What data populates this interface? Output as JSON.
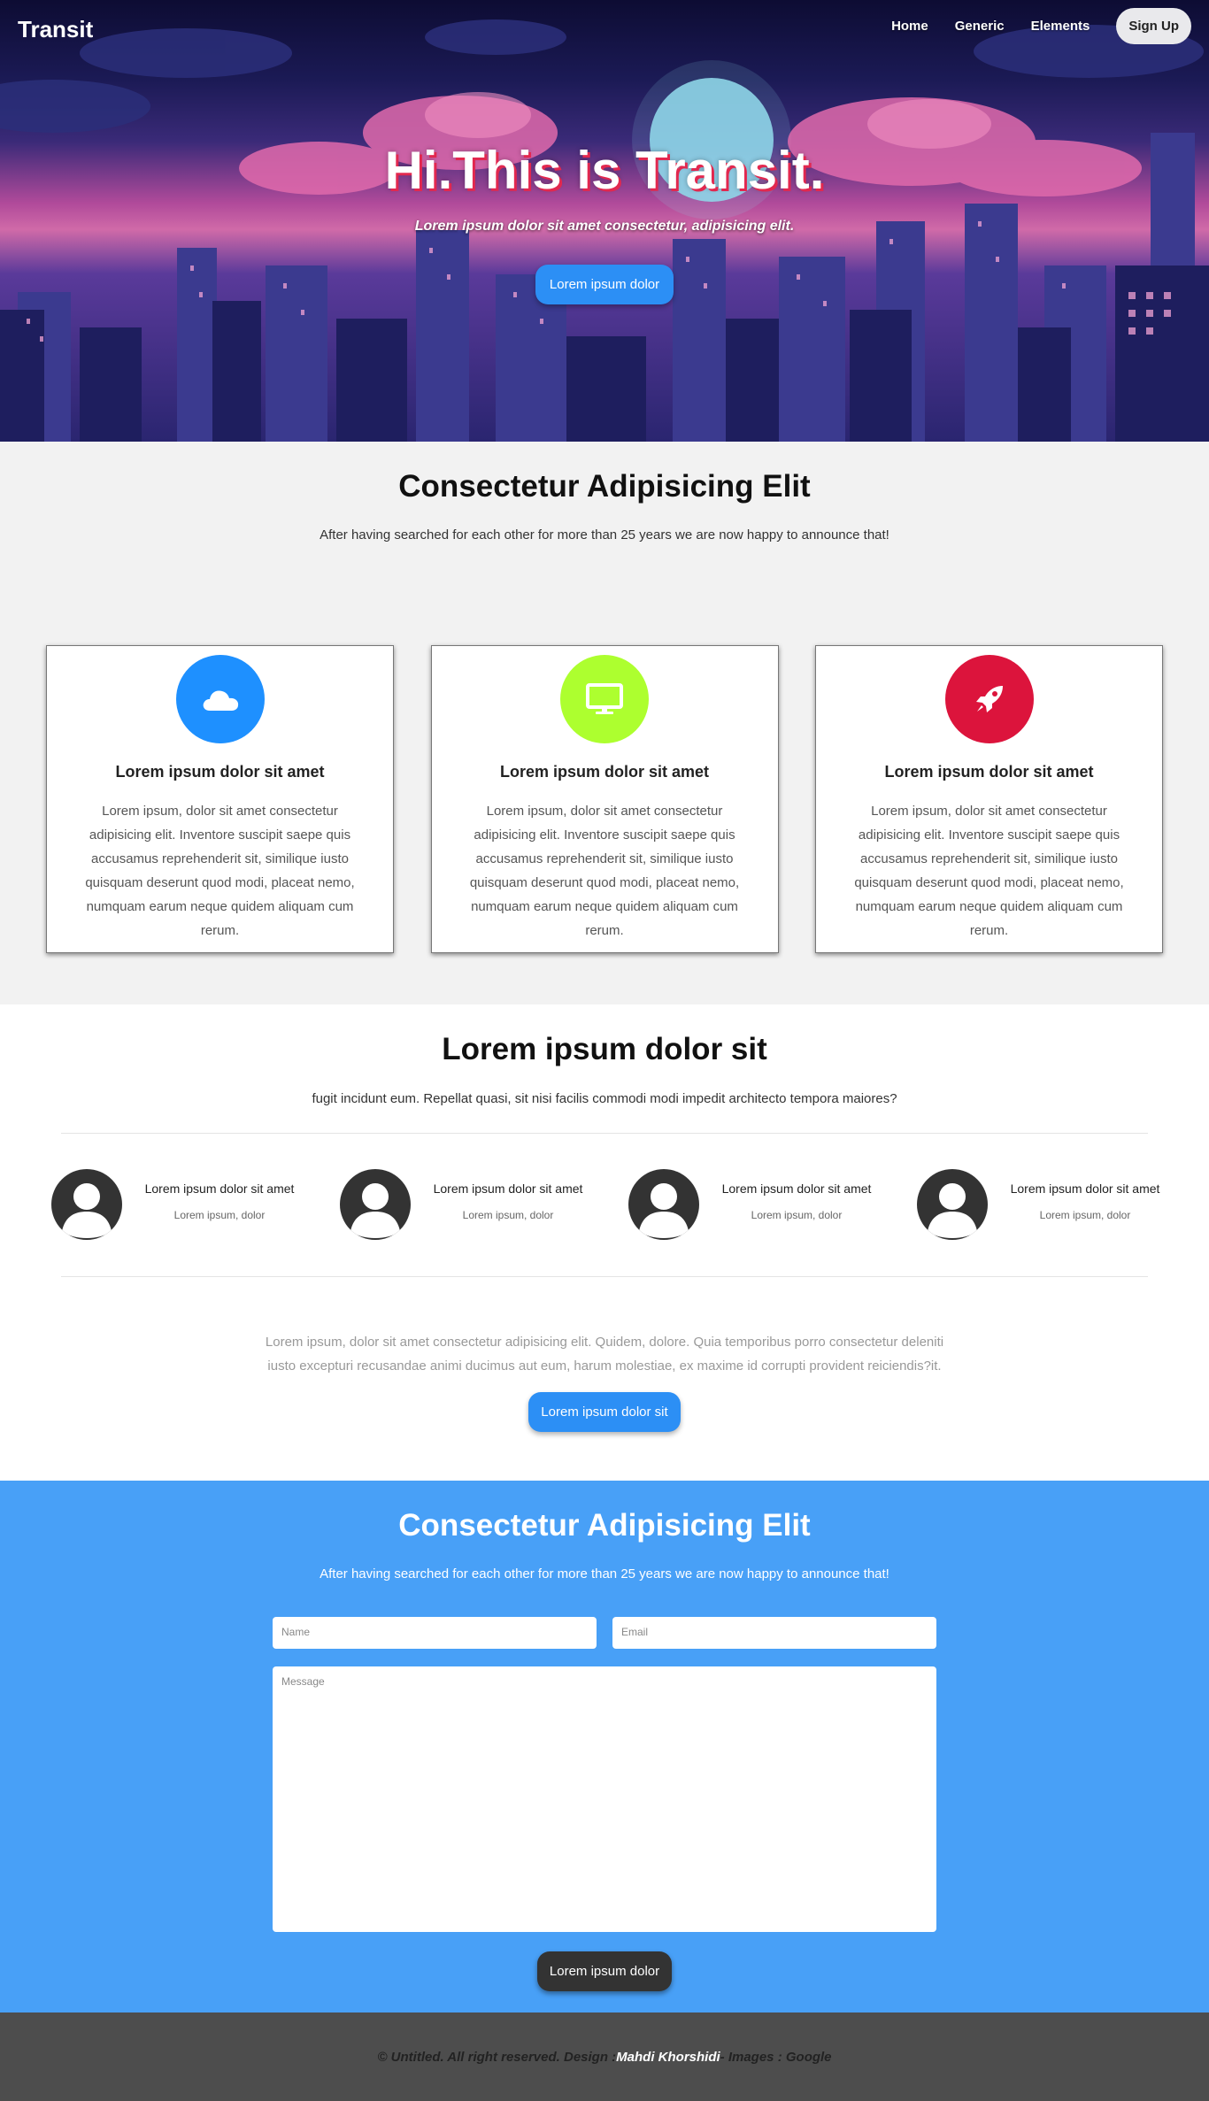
{
  "nav": {
    "brand": "Transit",
    "links": [
      "Home",
      "Generic",
      "Elements"
    ],
    "signup": "Sign Up"
  },
  "hero": {
    "title": "Hi.This is Transit.",
    "subtitle": "Lorem ipsum dolor sit amet consectetur, adipisicing elit.",
    "button": "Lorem ipsum dolor"
  },
  "features": {
    "title": "Consectetur Adipisicing Elit",
    "text": "After having searched for each other for more than 25 years we are now happy to announce that!",
    "cards": [
      {
        "icon": "cloud-icon",
        "color": "#1e90ff",
        "title": "Lorem ipsum dolor sit amet",
        "text": "Lorem ipsum, dolor sit amet consectetur adipisicing elit. Inventore suscipit saepe quis accusamus reprehenderit sit, similique iusto quisquam deserunt quod modi, placeat nemo, numquam earum neque quidem aliquam cum rerum."
      },
      {
        "icon": "monitor-icon",
        "color": "#adff2f",
        "title": "Lorem ipsum dolor sit amet",
        "text": "Lorem ipsum, dolor sit amet consectetur adipisicing elit. Inventore suscipit saepe quis accusamus reprehenderit sit, similique iusto quisquam deserunt quod modi, placeat nemo, numquam earum neque quidem aliquam cum rerum."
      },
      {
        "icon": "rocket-icon",
        "color": "#dc143c",
        "title": "Lorem ipsum dolor sit amet",
        "text": "Lorem ipsum, dolor sit amet consectetur adipisicing elit. Inventore suscipit saepe quis accusamus reprehenderit sit, similique iusto quisquam deserunt quod modi, placeat nemo, numquam earum neque quidem aliquam cum rerum."
      }
    ]
  },
  "team": {
    "title": "Lorem ipsum dolor sit",
    "text": "fugit incidunt eum. Repellat quasi, sit nisi facilis commodi modi impedit architecto tempora maiores?",
    "people": [
      {
        "name": "Lorem ipsum dolor sit amet",
        "role": "Lorem ipsum, dolor"
      },
      {
        "name": "Lorem ipsum dolor sit amet",
        "role": "Lorem ipsum, dolor"
      },
      {
        "name": "Lorem ipsum dolor sit amet",
        "role": "Lorem ipsum, dolor"
      },
      {
        "name": "Lorem ipsum dolor sit amet",
        "role": "Lorem ipsum, dolor"
      }
    ],
    "paragraph": "Lorem ipsum, dolor sit amet consectetur adipisicing elit. Quidem, dolore. Quia temporibus porro consectetur deleniti iusto excepturi recusandae animi ducimus aut eum, harum molestiae, ex maxime id corrupti provident reiciendis?it.",
    "button": "Lorem ipsum dolor sit"
  },
  "contact": {
    "title": "Consectetur Adipisicing Elit",
    "text": "After having searched for each other for more than 25 years we are now happy to announce that!",
    "name_placeholder": "Name",
    "email_placeholder": "Email",
    "message_placeholder": "Message",
    "button": "Lorem ipsum dolor"
  },
  "footer": {
    "prefix": "© Untitled. All right reserved. Design : ",
    "author": "Mahdi Khorshidi",
    "suffix": " - Images : Google"
  },
  "colors": {
    "accent": "#2c8ff5",
    "contact_bg": "#48a0f7",
    "footer_bg": "#4d4d4d"
  }
}
